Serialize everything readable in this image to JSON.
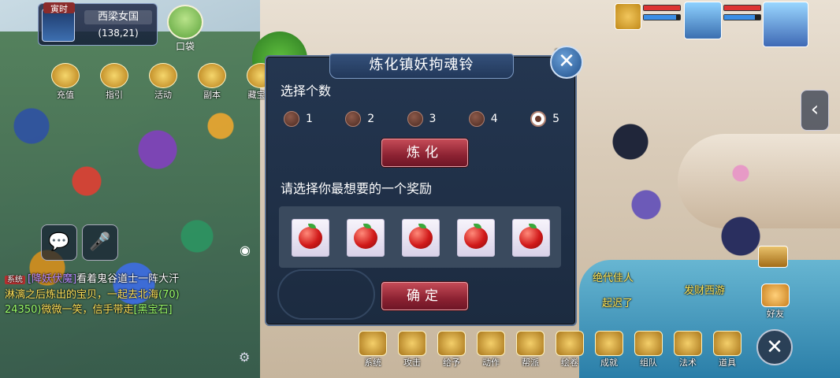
{
  "location": {
    "time_label": "寅时",
    "map_name": "西梁女国",
    "coords": "(138,21)"
  },
  "bag_label": "口袋",
  "top_buttons": [
    {
      "label": "充值",
      "icon": "gold-coin-icon"
    },
    {
      "label": "指引",
      "icon": "scroll-icon"
    },
    {
      "label": "活动",
      "icon": "event-icon"
    },
    {
      "label": "副本",
      "icon": "dungeon-icon"
    },
    {
      "label": "藏宝阁",
      "icon": "treasure-icon"
    }
  ],
  "status": {
    "pet_hp_pct": 100,
    "pet_mp_pct": 90,
    "player_hp_pct": 100,
    "player_mp_pct": 85
  },
  "dialog": {
    "title": "炼化镇妖拘魂铃",
    "select_count_label": "选择个数",
    "options": [
      "1",
      "2",
      "3",
      "4",
      "5"
    ],
    "selected_option": "5",
    "refine_button": "炼化",
    "reward_prompt": "请选择你最想要的一个奖励",
    "rewards": [
      {
        "icon": "red-apple-icon"
      },
      {
        "icon": "red-apple-icon"
      },
      {
        "icon": "red-apple-icon"
      },
      {
        "icon": "red-apple-icon"
      },
      {
        "icon": "red-apple-icon"
      }
    ],
    "confirm_button": "确定"
  },
  "chat": {
    "tag": "系统",
    "line1_name": "[降妖伏魔]",
    "line1_text": "看着鬼谷道士一阵大汗",
    "line2_text": "淋漓之后炼出的宝贝，一起去北海",
    "line2_num": "(70)",
    "line3_num": "24350)",
    "line3_text": "微微一笑，信手带走",
    "line3_item": "[黑宝石]"
  },
  "npc_labels": {
    "right_top": "路",
    "right_mid1": "绝代佳人",
    "right_mid2": "发财西游",
    "right_mid3": "起迟了"
  },
  "bottom_buttons": [
    {
      "label": "系统",
      "icon": "gear-icon"
    },
    {
      "label": "攻击",
      "icon": "sword-icon"
    },
    {
      "label": "给予",
      "icon": "give-icon"
    },
    {
      "label": "动作",
      "icon": "action-icon"
    },
    {
      "label": "帮派",
      "icon": "guild-icon"
    },
    {
      "label": "绘卷",
      "icon": "scroll-book-icon"
    },
    {
      "label": "成就",
      "icon": "peach-icon"
    },
    {
      "label": "组队",
      "icon": "team-icon"
    },
    {
      "label": "法术",
      "icon": "spell-icon"
    },
    {
      "label": "道具",
      "icon": "chest-icon"
    }
  ],
  "friends_label": "好友",
  "colors": {
    "dialog_bg": "#1c2b40",
    "button_red": "#8c2232",
    "accent_gold": "#f4cf6a"
  }
}
